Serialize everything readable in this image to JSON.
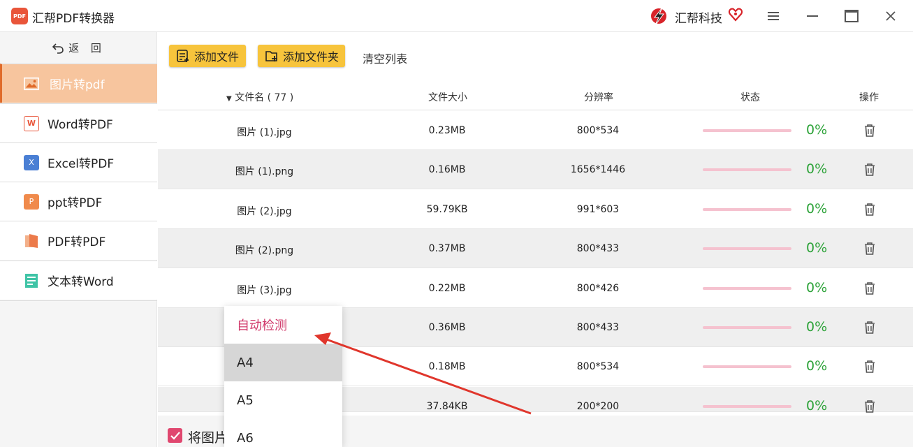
{
  "app": {
    "logo_text": "PDF",
    "title": "汇帮PDF转换器",
    "brand": "汇帮科技"
  },
  "colors": {
    "accent": "#f7c43c",
    "active": "#f7c59e",
    "progress": "#f5c2cf",
    "percent": "#2ea33a",
    "check": "#e0476f"
  },
  "sidebar": {
    "back_label": "返 回",
    "items": [
      {
        "label": "图片转pdf",
        "icon": "image-icon",
        "icon_text": ""
      },
      {
        "label": "Word转PDF",
        "icon": "word-icon",
        "icon_text": "W"
      },
      {
        "label": "Excel转PDF",
        "icon": "excel-icon",
        "icon_text": "X"
      },
      {
        "label": "ppt转PDF",
        "icon": "ppt-icon",
        "icon_text": "P"
      },
      {
        "label": "PDF转PDF",
        "icon": "pdf-icon",
        "icon_text": ""
      },
      {
        "label": "文本转Word",
        "icon": "text-icon",
        "icon_text": ""
      }
    ]
  },
  "toolbar": {
    "add_file": "添加文件",
    "add_folder": "添加文件夹",
    "clear_list": "清空列表"
  },
  "table": {
    "headers": {
      "name": "文件名 ( 77 )",
      "size": "文件大小",
      "resolution": "分辨率",
      "status": "状态",
      "action": "操作"
    },
    "rows": [
      {
        "name": "图片 (1).jpg",
        "size": "0.23MB",
        "resolution": "800*534",
        "progress": 0,
        "percent": "0%"
      },
      {
        "name": "图片 (1).png",
        "size": "0.16MB",
        "resolution": "1656*1446",
        "progress": 0,
        "percent": "0%"
      },
      {
        "name": "图片 (2).jpg",
        "size": "59.79KB",
        "resolution": "991*603",
        "progress": 0,
        "percent": "0%"
      },
      {
        "name": "图片 (2).png",
        "size": "0.37MB",
        "resolution": "800*433",
        "progress": 0,
        "percent": "0%"
      },
      {
        "name": "图片 (3).jpg",
        "size": "0.22MB",
        "resolution": "800*426",
        "progress": 0,
        "percent": "0%"
      },
      {
        "name": "",
        "size": "0.36MB",
        "resolution": "800*433",
        "progress": 0,
        "percent": "0%"
      },
      {
        "name": "",
        "size": "0.18MB",
        "resolution": "800*534",
        "progress": 0,
        "percent": "0%"
      },
      {
        "name": "",
        "size": "37.84KB",
        "resolution": "200*200",
        "progress": 0,
        "percent": "0%"
      }
    ]
  },
  "bottom": {
    "checkbox_label": "将图片"
  },
  "dropdown": {
    "options": [
      "自动检测",
      "A4",
      "A5",
      "A6"
    ],
    "selected": "自动检测",
    "hovered": "A4"
  }
}
